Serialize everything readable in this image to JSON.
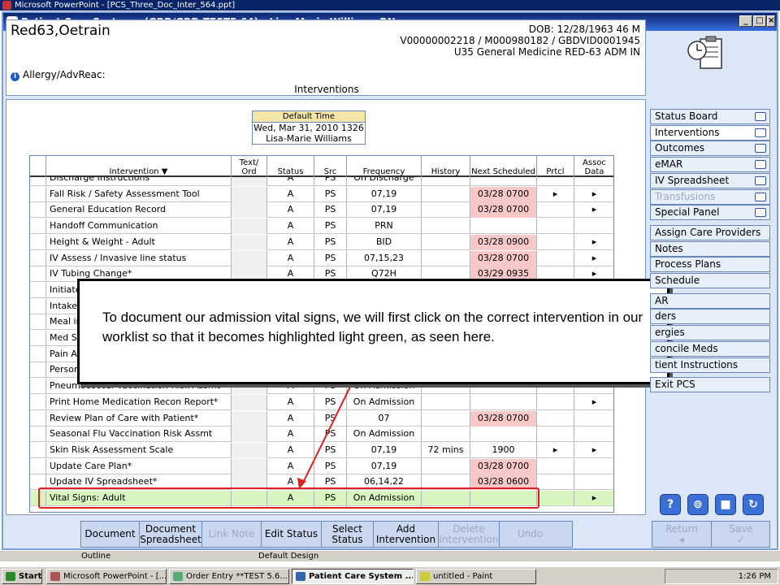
{
  "ppt_title": "Microsoft PowerPoint - [PCS_Three_Doc_Inter_564.ppt]",
  "window_title": "Patient Care System - (GBD/GBD.TEST5.64) - Lisa-Marie Williams RN",
  "patient": {
    "name": "Red63,Oetrain",
    "dob": "DOB: 12/28/1963 46 M",
    "ids": "V00000002218 / M000980182 / GBDVID0001945",
    "location": "U35 General Medicine  RED-63  ADM IN",
    "allergy": "Allergy/AdvReac:"
  },
  "section_title": "Interventions",
  "default_time": {
    "header": "Default Time",
    "date": "Wed, Mar 31, 2010  1326",
    "user": "Lisa-Marie Williams"
  },
  "columns": [
    "Intervention ▼",
    "Text/ Ord",
    "Status",
    "Src",
    "Frequency",
    "History",
    "Next Scheduled",
    "Prtcl",
    "Assoc Data"
  ],
  "rows": [
    {
      "name": "Discharge Instructions",
      "status": "A",
      "src": "PS",
      "freq": "On Discharge",
      "history": "",
      "next": "",
      "prtcl": "",
      "assoc": "",
      "next_hl": false
    },
    {
      "name": "Fall Risk / Safety Assessment Tool",
      "status": "A",
      "src": "PS",
      "freq": "07,19",
      "history": "",
      "next": "03/28 0700",
      "prtcl": "▸",
      "assoc": "▸",
      "next_hl": true
    },
    {
      "name": "General Education Record",
      "status": "A",
      "src": "PS",
      "freq": "07,19",
      "history": "",
      "next": "03/28 0700",
      "prtcl": "",
      "assoc": "▸",
      "next_hl": true
    },
    {
      "name": "Handoff Communication",
      "status": "A",
      "src": "PS",
      "freq": "PRN",
      "history": "",
      "next": "",
      "prtcl": "",
      "assoc": "",
      "next_hl": false
    },
    {
      "name": "Height & Weight - Adult",
      "status": "A",
      "src": "PS",
      "freq": "BID",
      "history": "",
      "next": "03/28 0900",
      "prtcl": "",
      "assoc": "▸",
      "next_hl": true
    },
    {
      "name": "IV Assess / Invasive line status",
      "status": "A",
      "src": "PS",
      "freq": "07,15,23",
      "history": "",
      "next": "03/28 0700",
      "prtcl": "",
      "assoc": "▸",
      "next_hl": true
    },
    {
      "name": "IV Tubing Change*",
      "status": "A",
      "src": "PS",
      "freq": "Q72H",
      "history": "",
      "next": "03/29 0935",
      "prtcl": "",
      "assoc": "▸",
      "next_hl": true
    },
    {
      "name": "Initiate",
      "status": "",
      "src": "",
      "freq": "",
      "history": "",
      "next": "",
      "prtcl": "",
      "assoc": "",
      "next_hl": false
    },
    {
      "name": "Intake",
      "status": "",
      "src": "",
      "freq": "",
      "history": "",
      "next": "",
      "prtcl": "",
      "assoc": "",
      "next_hl": false
    },
    {
      "name": "Meal in",
      "status": "",
      "src": "",
      "freq": "",
      "history": "",
      "next": "",
      "prtcl": "",
      "assoc": "",
      "next_hl": false
    },
    {
      "name": "Med S",
      "status": "",
      "src": "",
      "freq": "",
      "history": "",
      "next": "",
      "prtcl": "",
      "assoc": "",
      "next_hl": false
    },
    {
      "name": "Pain A",
      "status": "",
      "src": "",
      "freq": "",
      "history": "",
      "next": "",
      "prtcl": "",
      "assoc": "",
      "next_hl": false
    },
    {
      "name": "Person",
      "status": "",
      "src": "",
      "freq": "",
      "history": "",
      "next": "",
      "prtcl": "",
      "assoc": "",
      "next_hl": false
    },
    {
      "name": "Pneumococcal Vaccination Risk Assmt",
      "status": "A",
      "src": "PS",
      "freq": "On Admission",
      "history": "",
      "next": "",
      "prtcl": "",
      "assoc": "",
      "next_hl": false
    },
    {
      "name": "Print Home Medication Recon Report*",
      "status": "A",
      "src": "PS",
      "freq": "On Admission",
      "history": "",
      "next": "",
      "prtcl": "",
      "assoc": "▸",
      "next_hl": false
    },
    {
      "name": "Review Plan of Care with Patient*",
      "status": "A",
      "src": "PS",
      "freq": "07",
      "history": "",
      "next": "03/28 0700",
      "prtcl": "",
      "assoc": "",
      "next_hl": true
    },
    {
      "name": "Seasonal Flu Vaccination Risk Assmt",
      "status": "A",
      "src": "PS",
      "freq": "On Admission",
      "history": "",
      "next": "",
      "prtcl": "",
      "assoc": "",
      "next_hl": false
    },
    {
      "name": "Skin Risk Assessment Scale",
      "status": "A",
      "src": "PS",
      "freq": "07,19",
      "history": "72 mins",
      "next": "1900",
      "prtcl": "▸",
      "assoc": "▸",
      "next_hl": false
    },
    {
      "name": "Update Care Plan*",
      "status": "A",
      "src": "PS",
      "freq": "07,19",
      "history": "",
      "next": "03/28 0700",
      "prtcl": "",
      "assoc": "",
      "next_hl": true
    },
    {
      "name": "Update IV Spreadsheet*",
      "status": "A",
      "src": "PS",
      "freq": "06,14,22",
      "history": "",
      "next": "03/28 0600",
      "prtcl": "",
      "assoc": "",
      "next_hl": true
    },
    {
      "name": "Vital Signs: Adult",
      "status": "A",
      "src": "PS",
      "freq": "On Admission",
      "history": "",
      "next": "",
      "prtcl": "",
      "assoc": "▸",
      "next_hl": false
    }
  ],
  "callout": "To document our admission vital signs, we will first click on the correct intervention in our worklist so that it becomes highlighted light green, as seen here.",
  "side_group1": [
    "Status Board",
    "Interventions",
    "Outcomes",
    "eMAR",
    "IV Spreadsheet",
    "Transfusions",
    "Special Panel"
  ],
  "side_group2": [
    "Assign Care Providers",
    "Notes",
    "Process Plans",
    "Schedule"
  ],
  "side_group3": [
    "AR",
    "ders",
    "ergies",
    "concile Meds",
    "tient Instructions"
  ],
  "side_group4": [
    "Exit PCS"
  ],
  "toolbar": [
    {
      "label": "Document",
      "enabled": true
    },
    {
      "label": "Document Spreadsheet",
      "enabled": true
    },
    {
      "label": "Link Note",
      "enabled": false
    },
    {
      "label": "Edit Status",
      "enabled": true
    },
    {
      "label": "Select Status",
      "enabled": true
    },
    {
      "label": "Add Intervention",
      "enabled": true
    },
    {
      "label": "Delete Intervention",
      "enabled": false
    },
    {
      "label": "Undo",
      "enabled": false
    }
  ],
  "return_label": "Return",
  "save_label": "Save",
  "ppt_status": {
    "outline": "Outline",
    "design": "Default Design"
  },
  "taskbar": {
    "start": "Start",
    "tasks": [
      "Microsoft PowerPoint - [...",
      "Order Entry **TEST 5.6...",
      "Patient Care System ...",
      "untitled - Paint"
    ],
    "clock": "1:26 PM"
  }
}
